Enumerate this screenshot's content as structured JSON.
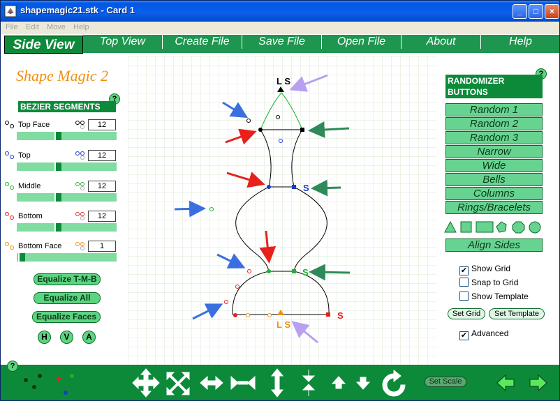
{
  "window": {
    "title": "shapemagic21.stk - Card 1",
    "min_glyph": "_",
    "max_glyph": "□",
    "close_glyph": "×"
  },
  "menu": [
    "File",
    "Edit",
    "Move",
    "Help"
  ],
  "toolbar": {
    "active_tab": "Side View",
    "tabs": [
      "Top View",
      "Create File",
      "Save File",
      "Open File",
      "About",
      "Help"
    ]
  },
  "left_panel": {
    "app_title": "Shape Magic 2",
    "help": "?",
    "bezier_header": "BEZIER SEGMENTS",
    "segments": [
      {
        "label": "Top Face",
        "value": "12",
        "slider": 0.4
      },
      {
        "label": "Top",
        "value": "12",
        "slider": 0.4
      },
      {
        "label": "Middle",
        "value": "12",
        "slider": 0.4
      },
      {
        "label": "Bottom",
        "value": "12",
        "slider": 0.4
      },
      {
        "label": "Bottom Face",
        "value": "1",
        "slider": 0.0
      }
    ],
    "equalize_buttons": [
      "Equalize T-M-B",
      "Equalize All",
      "Equalize Faces"
    ],
    "hva": [
      "H",
      "V",
      "A"
    ]
  },
  "canvas": {
    "labels": {
      "ls_top": "L S",
      "s_top": "S",
      "s_mid": "S",
      "s_bottom": "S",
      "ls_bottom": "L S"
    }
  },
  "right_panel": {
    "help": "?",
    "randomizer_header": "RANDOMIZER BUTTONS",
    "buttons": [
      "Random 1",
      "Random 2",
      "Random 3",
      "Narrow",
      "Wide",
      "Bells",
      "Columns",
      "Rings/Bracelets"
    ],
    "align_sides": "Align Sides",
    "checkboxes": [
      {
        "label": "Show Grid",
        "checked": true
      },
      {
        "label": "Snap to Grid",
        "checked": false
      },
      {
        "label": "Show Template",
        "checked": false
      }
    ],
    "set_grid": "Set Grid",
    "set_template": "Set Template",
    "advanced": {
      "label": "Advanced",
      "checked": true
    },
    "check_glyph": "✔"
  },
  "bottom": {
    "help": "?",
    "set_scale": "Set Scale"
  },
  "colors": {
    "green_dark": "#0c8a3a",
    "green_light": "#66d490",
    "title_orange": "#f09010",
    "grid_line": "#d8e8d0",
    "arrow_blue": "#3b6fe0",
    "arrow_red": "#e8201c",
    "arrow_green": "#2e8a5a",
    "arrow_lilac": "#b8a0f0"
  }
}
